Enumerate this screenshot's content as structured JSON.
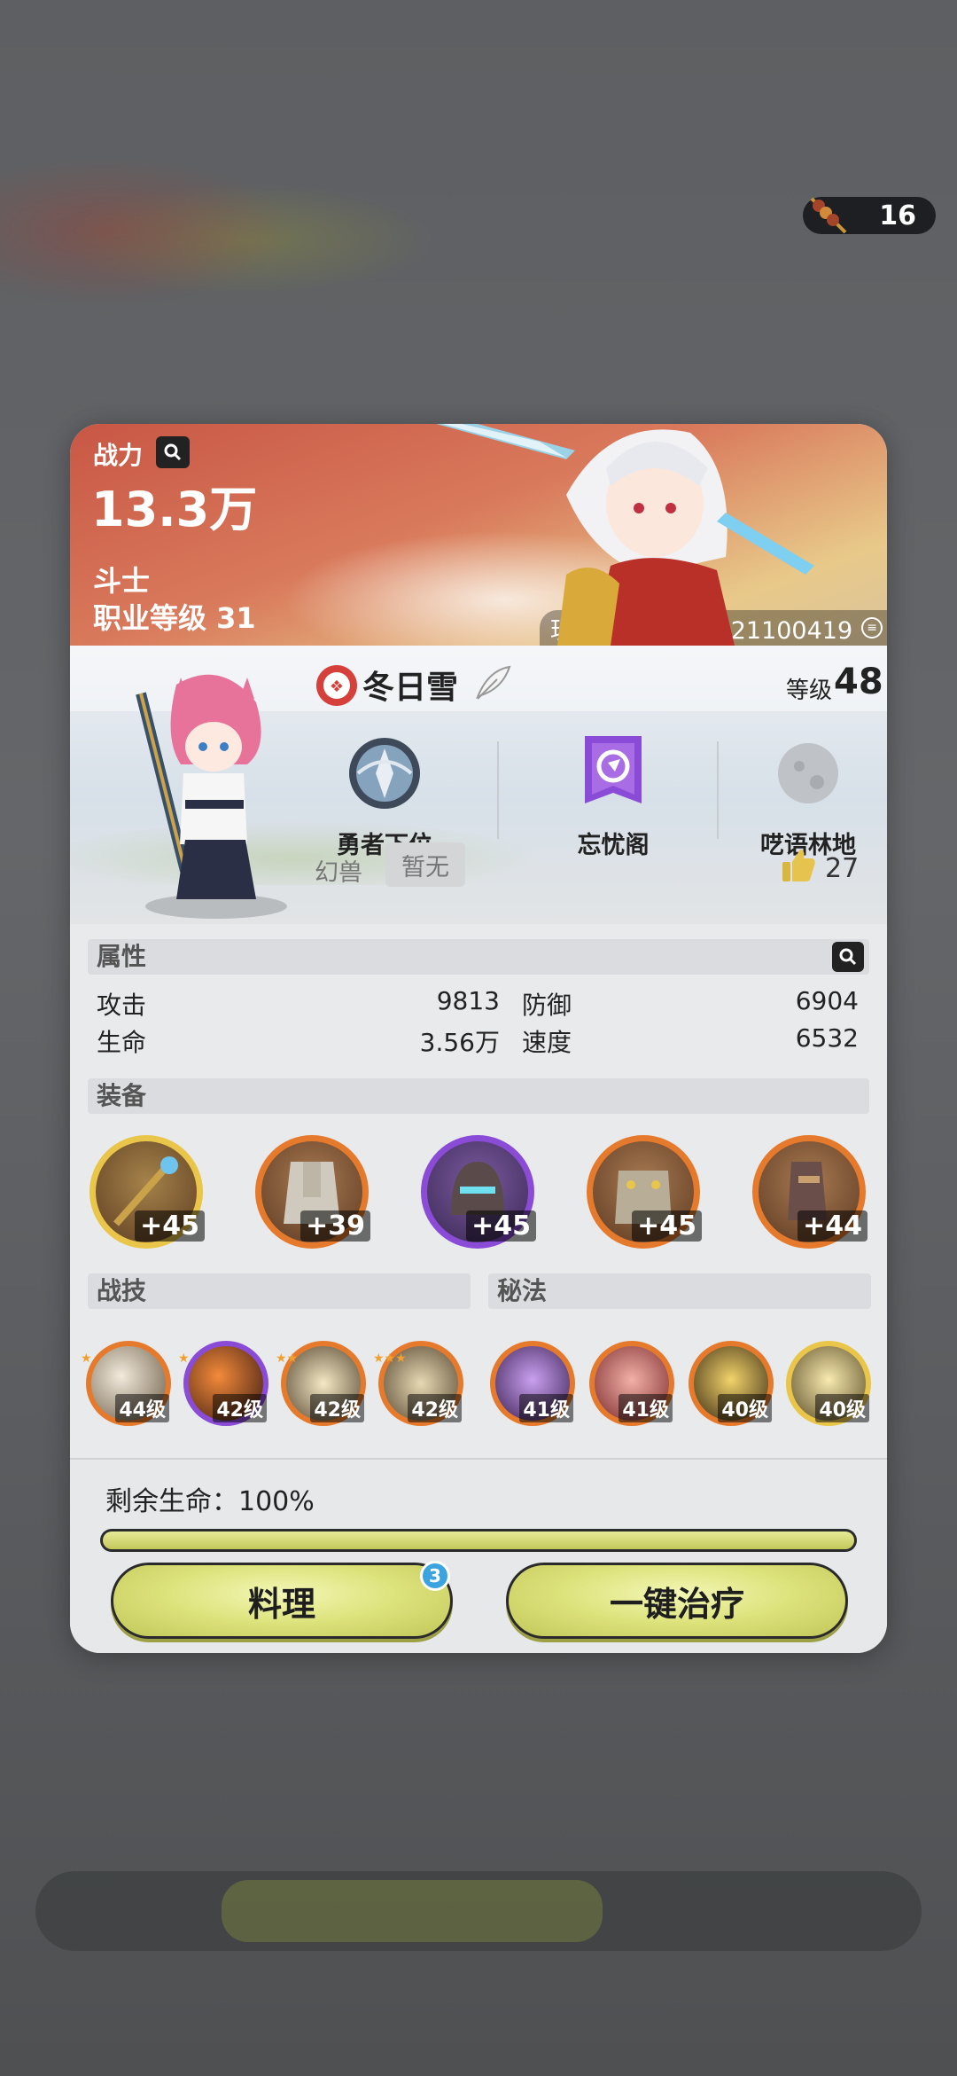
{
  "currency": {
    "icon": "skewer-food-icon",
    "count": "16"
  },
  "header": {
    "power_label": "战力",
    "power_value": "13.3万",
    "class_name": "斗士",
    "class_level": "职业等级 31",
    "player_id": "玩家编号：801221100419"
  },
  "profile": {
    "name": "冬日雪",
    "level_label": "等级",
    "level_value": "48",
    "rank": "勇者下位",
    "guild": "忘忧阁",
    "location": "呓语林地",
    "pet_label": "幻兽",
    "pet_value": "暂无",
    "likes": "27"
  },
  "attributes": {
    "title": "属性",
    "items": [
      {
        "label": "攻击",
        "value": "9813"
      },
      {
        "label": "防御",
        "value": "6904"
      },
      {
        "label": "生命",
        "value": "3.56万"
      },
      {
        "label": "速度",
        "value": "6532"
      }
    ]
  },
  "equipment": {
    "title": "装备",
    "items": [
      {
        "name": "weapon-staff",
        "level": "+45",
        "rarity": "gold"
      },
      {
        "name": "armor-chest",
        "level": "+39",
        "rarity": "orange"
      },
      {
        "name": "helmet",
        "level": "+45",
        "rarity": "purple"
      },
      {
        "name": "gauntlets",
        "level": "+45",
        "rarity": "orange"
      },
      {
        "name": "boots",
        "level": "+44",
        "rarity": "orange"
      }
    ]
  },
  "skills": {
    "combat_title": "战技",
    "magic_title": "秘法",
    "items": [
      {
        "level": "44级",
        "rarity": "orange"
      },
      {
        "level": "42级",
        "rarity": "purple"
      },
      {
        "level": "42级",
        "rarity": "orange"
      },
      {
        "level": "42级",
        "rarity": "orange"
      },
      {
        "level": "41级",
        "rarity": "orange"
      },
      {
        "level": "41级",
        "rarity": "orange"
      },
      {
        "level": "40级",
        "rarity": "orange"
      },
      {
        "level": "40级",
        "rarity": "gold"
      }
    ]
  },
  "bottom": {
    "hp_text": "剩余生命：100%",
    "hp_percent": 100,
    "cook_label": "料理",
    "cook_badge": "3",
    "heal_label": "一键治疗"
  },
  "colors": {
    "gold": "#e9c64a",
    "orange": "#e67a2c",
    "purple": "#8a4bd6",
    "accent_button": "#dce27a"
  }
}
